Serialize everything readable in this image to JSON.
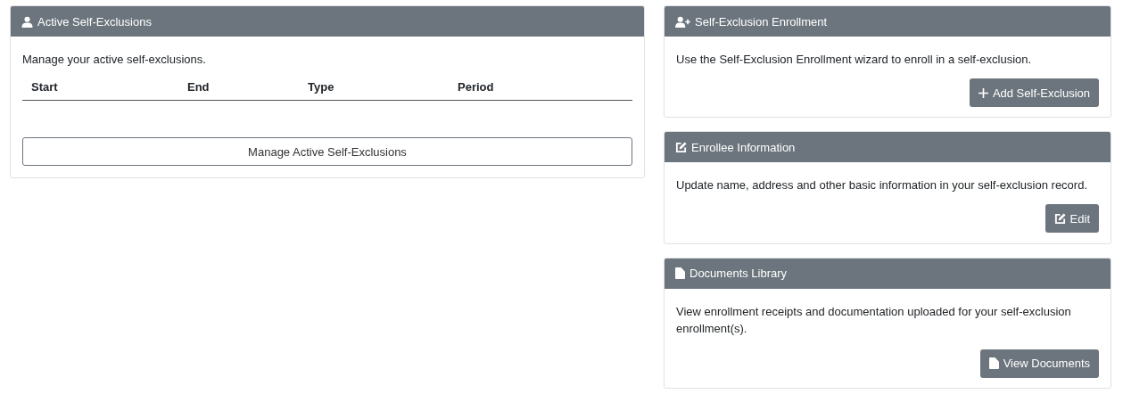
{
  "active_panel": {
    "title": "Active Self-Exclusions",
    "description": "Manage your active self-exclusions.",
    "table": {
      "columns": [
        "Start",
        "End",
        "Type",
        "Period"
      ]
    },
    "button": "Manage Active Self-Exclusions"
  },
  "side_panels": [
    {
      "kind": "enrollment",
      "title": "Self-Exclusion Enrollment",
      "description": "Use the Self-Exclusion Enrollment wizard to enroll in a self-exclusion.",
      "button": "Add Self-Exclusion"
    },
    {
      "kind": "enrollee",
      "title": "Enrollee Information",
      "description": "Update name, address and other basic information in your self-exclusion record.",
      "button": "Edit"
    },
    {
      "kind": "documents",
      "title": "Documents Library",
      "description": "View enrollment receipts and documentation uploaded for your self-exclusion enrollment(s).",
      "button": "View Documents"
    }
  ]
}
